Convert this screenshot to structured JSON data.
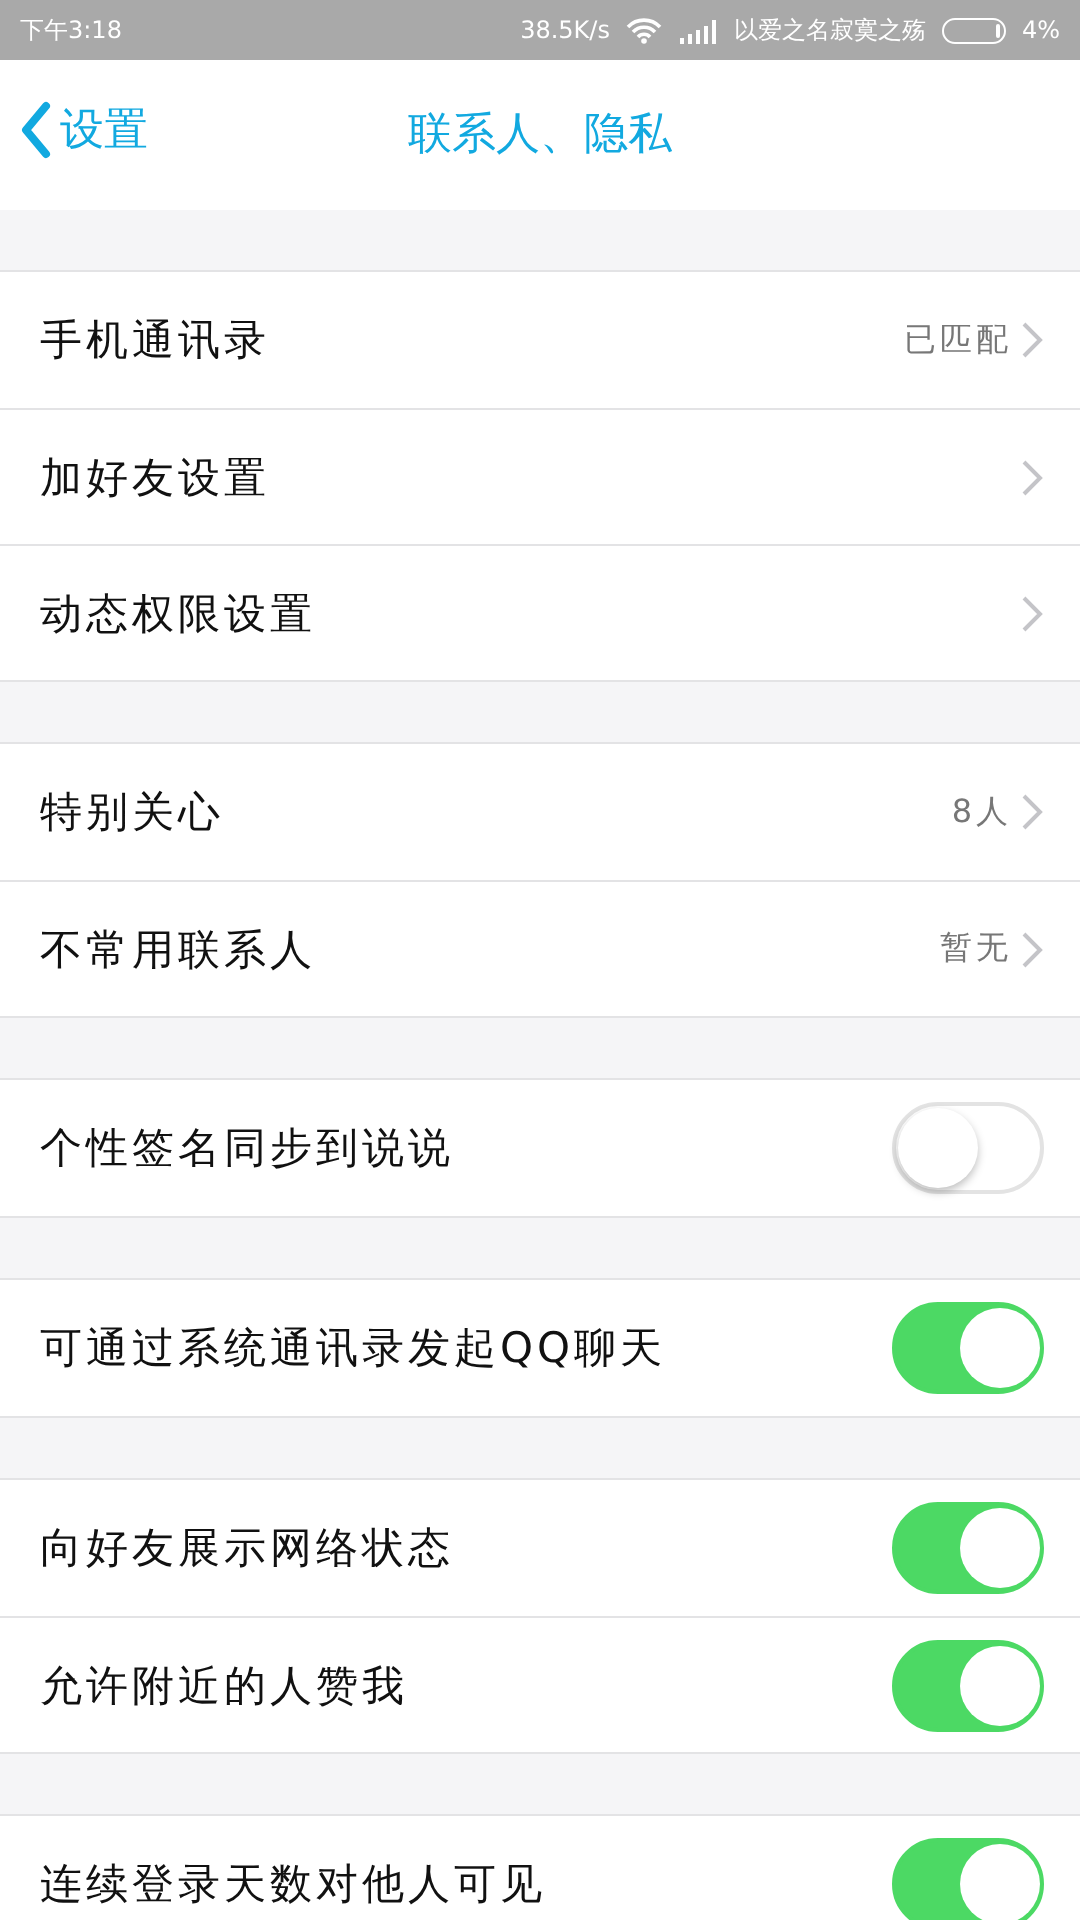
{
  "status_bar": {
    "time": "下午3:18",
    "speed": "38.5K/s",
    "carrier": "以爱之名寂寞之殇",
    "battery": "4%"
  },
  "nav": {
    "back": "设置",
    "title": "联系人、隐私"
  },
  "groups": [
    {
      "rows": [
        {
          "kind": "link",
          "label": "手机通讯录",
          "value": "已匹配"
        },
        {
          "kind": "link",
          "label": "加好友设置"
        },
        {
          "kind": "link",
          "label": "动态权限设置"
        }
      ]
    },
    {
      "rows": [
        {
          "kind": "link",
          "label": "特别关心",
          "value": "8人"
        },
        {
          "kind": "link",
          "label": "不常用联系人",
          "value": "暂无"
        }
      ]
    },
    {
      "rows": [
        {
          "kind": "toggle",
          "label": "个性签名同步到说说",
          "on": false
        }
      ]
    },
    {
      "rows": [
        {
          "kind": "toggle",
          "label": "可通过系统通讯录发起QQ聊天",
          "on": true
        }
      ]
    },
    {
      "rows": [
        {
          "kind": "toggle",
          "label": "向好友展示网络状态",
          "on": true
        },
        {
          "kind": "toggle",
          "label": "允许附近的人赞我",
          "on": true
        }
      ]
    },
    {
      "rows": [
        {
          "kind": "toggle",
          "label": "连续登录天数对他人可见",
          "on": true
        }
      ]
    }
  ]
}
